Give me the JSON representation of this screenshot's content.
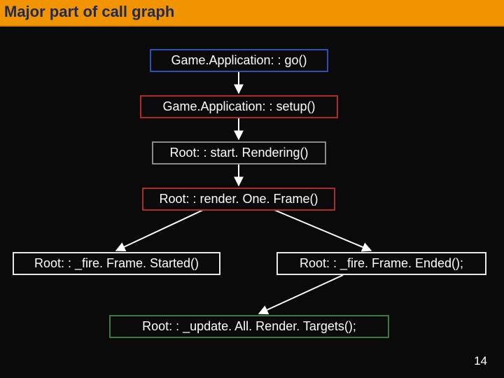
{
  "title": "Major part of call graph",
  "page_number": "14",
  "colors": {
    "titlebar_bg": "#f29400",
    "title_text": "#1e2a5a",
    "slide_bg": "#0a0a0a",
    "arrow": "#ffffff",
    "border_blue": "#2e4fb3",
    "border_red": "#b02a2a",
    "border_gray": "#8a8a8a",
    "border_white": "#e8e8e8",
    "border_green": "#3a7a3a"
  },
  "nodes": {
    "go": {
      "label": "Game.Application: : go()",
      "border": "blue"
    },
    "setup": {
      "label": "Game.Application: : setup()",
      "border": "red"
    },
    "startRender": {
      "label": "Root: : start. Rendering()",
      "border": "gray"
    },
    "renderOne": {
      "label": "Root: : render. One. Frame()",
      "border": "red"
    },
    "fireStarted": {
      "label": "Root: : _fire. Frame. Started()",
      "border": "white"
    },
    "fireEnded": {
      "label": "Root: : _fire. Frame. Ended();",
      "border": "white"
    },
    "updateTargets": {
      "label": "Root: : _update. All. Render. Targets();",
      "border": "green"
    }
  },
  "edges": [
    {
      "from": "go",
      "to": "setup"
    },
    {
      "from": "setup",
      "to": "startRender"
    },
    {
      "from": "startRender",
      "to": "renderOne"
    },
    {
      "from": "renderOne",
      "to": "fireStarted"
    },
    {
      "from": "renderOne",
      "to": "fireEnded"
    },
    {
      "from": "fireEnded",
      "to": "updateTargets"
    }
  ]
}
